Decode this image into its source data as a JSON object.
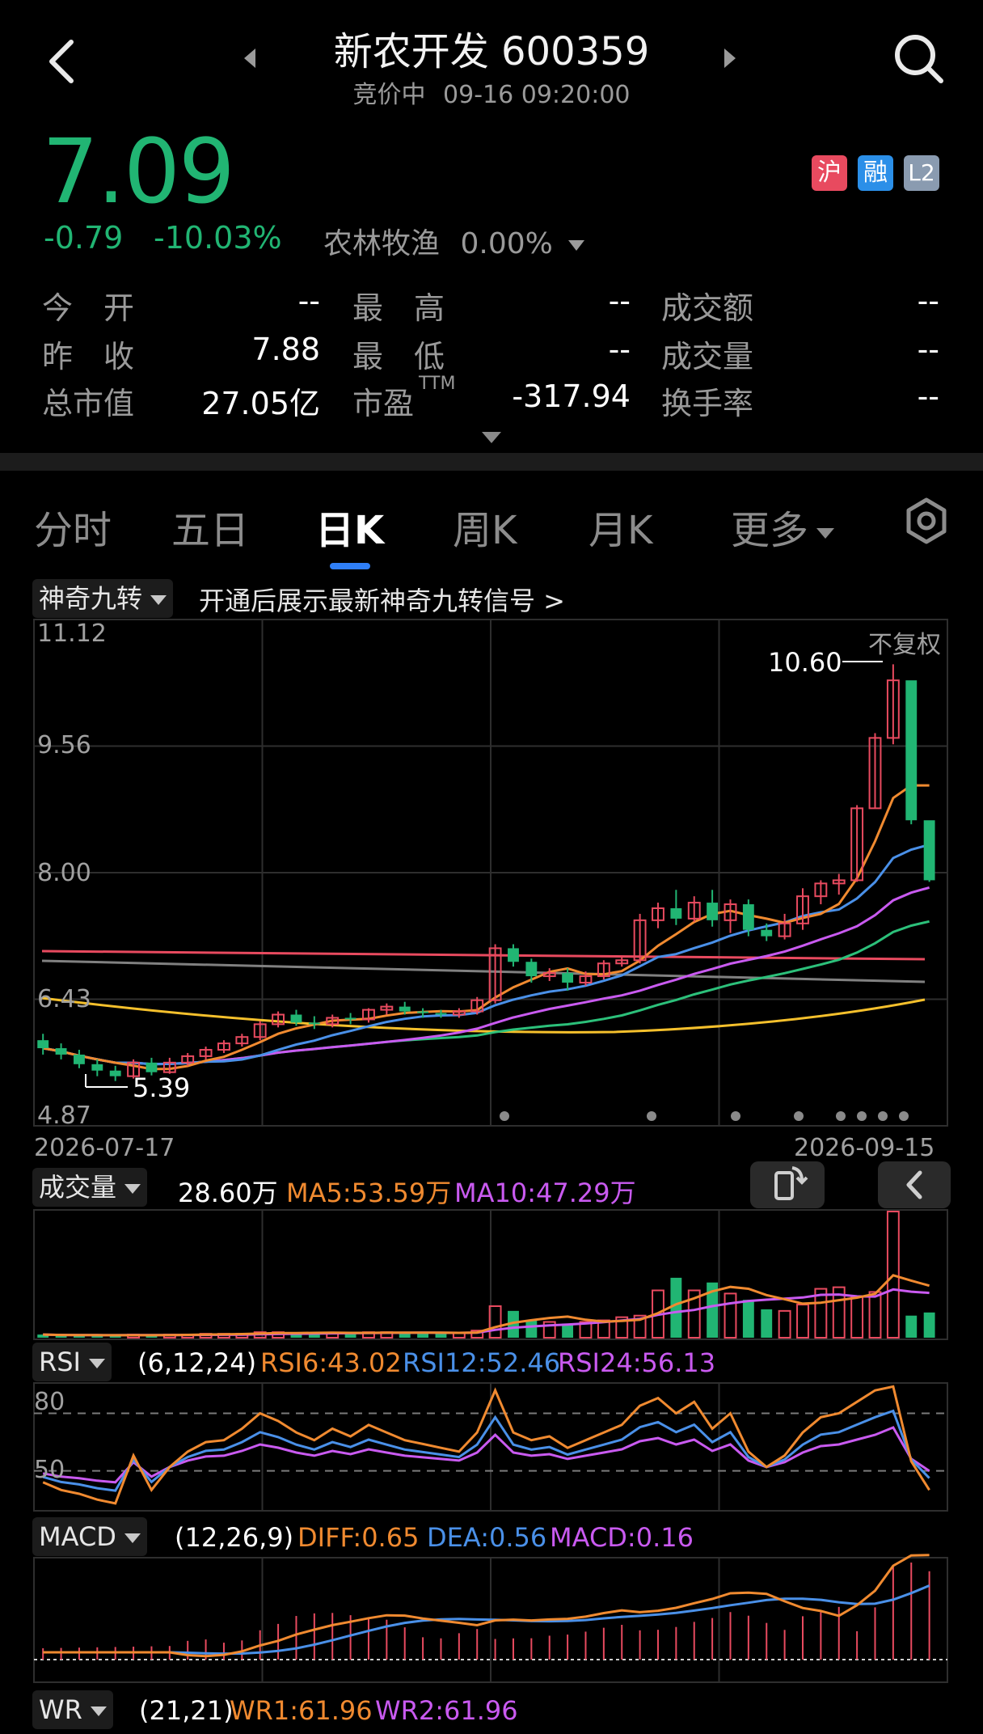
{
  "header": {
    "title": "新农开发 600359",
    "status": "竞价中",
    "datetime": "09-16 09:20:00"
  },
  "quote": {
    "price": "7.09",
    "change": "-0.79",
    "change_pct": "-10.03%",
    "sector_name": "农林牧渔",
    "sector_pct": "0.00%",
    "badges": [
      {
        "text": "沪",
        "color": "#e84a5f"
      },
      {
        "text": "融",
        "color": "#2b8fe8"
      },
      {
        "text": "L2",
        "color": "#8a9bb0"
      }
    ],
    "rows": [
      [
        {
          "label": "今　开",
          "value": "--"
        },
        {
          "label": "最　高",
          "value": "--"
        },
        {
          "label": "成交额",
          "value": "--"
        }
      ],
      [
        {
          "label": "昨　收",
          "value": "7.88"
        },
        {
          "label": "最　低",
          "value": "--"
        },
        {
          "label": "成交量",
          "value": "--"
        }
      ],
      [
        {
          "label": "总市值",
          "value": "27.05亿"
        },
        {
          "label": "市盈",
          "value": "-317.94"
        },
        {
          "label": "换手率",
          "value": "--"
        }
      ]
    ],
    "pe_sup": "TTM"
  },
  "tabs": [
    "分时",
    "五日",
    "日K",
    "周K",
    "月K",
    "更多"
  ],
  "active_tab": "日K",
  "kline": {
    "indicator_select": "神奇九转",
    "promo_text": "开通后展示最新神奇九转信号 >",
    "adjust_label": "不复权",
    "y_ticks": [
      "11.12",
      "9.56",
      "8.00",
      "6.43",
      "4.87"
    ],
    "date_start": "2026-07-17",
    "date_end": "2026-09-15",
    "max_label": "10.60",
    "min_label": "5.39"
  },
  "volume": {
    "select": "成交量",
    "current": "28.60万",
    "ma5": "MA5:53.59万",
    "ma10": "MA10:47.29万"
  },
  "rsi": {
    "select": "RSI",
    "params": "(6,12,24)",
    "rsi6": "RSI6:43.02",
    "rsi12": "RSI12:52.46",
    "rsi24": "RSI24:56.13",
    "levels": [
      "80",
      "50"
    ]
  },
  "macd": {
    "select": "MACD",
    "params": "(12,26,9)",
    "diff": "DIFF:0.65",
    "dea": "DEA:0.56",
    "macd": "MACD:0.16"
  },
  "wr": {
    "select": "WR",
    "params": "(21,21)",
    "wr1": "WR1:61.96",
    "wr2": "WR2:61.96"
  },
  "colors": {
    "up": "#e84a5f",
    "down": "#21b573",
    "ma5": "#f08a30",
    "ma10": "#4a90e8",
    "ma20": "#c95af0",
    "ma30": "#2cc07a",
    "ma60": "#808080",
    "ma120": "#f5c02c",
    "ma250": "#e84a5f"
  },
  "chart_data": {
    "type": "candlestick",
    "x_range": [
      "2026-07-17",
      "2026-09-15"
    ],
    "ylim": [
      4.87,
      11.12
    ],
    "candles": [
      [
        5.9,
        5.8,
        5.98,
        5.72
      ],
      [
        5.8,
        5.72,
        5.86,
        5.66
      ],
      [
        5.72,
        5.6,
        5.78,
        5.55
      ],
      [
        5.6,
        5.52,
        5.66,
        5.45
      ],
      [
        5.52,
        5.45,
        5.58,
        5.39
      ],
      [
        5.45,
        5.62,
        5.66,
        5.42
      ],
      [
        5.62,
        5.5,
        5.68,
        5.46
      ],
      [
        5.5,
        5.62,
        5.68,
        5.48
      ],
      [
        5.62,
        5.7,
        5.74,
        5.58
      ],
      [
        5.7,
        5.78,
        5.82,
        5.66
      ],
      [
        5.78,
        5.86,
        5.9,
        5.74
      ],
      [
        5.86,
        5.94,
        5.98,
        5.82
      ],
      [
        5.94,
        6.1,
        6.14,
        5.9
      ],
      [
        6.1,
        6.22,
        6.26,
        6.06
      ],
      [
        6.22,
        6.12,
        6.28,
        6.08
      ],
      [
        6.12,
        6.1,
        6.2,
        6.04
      ],
      [
        6.1,
        6.18,
        6.22,
        6.06
      ],
      [
        6.18,
        6.16,
        6.24,
        6.1
      ],
      [
        6.16,
        6.28,
        6.3,
        6.12
      ],
      [
        6.28,
        6.32,
        6.36,
        6.22
      ],
      [
        6.32,
        6.26,
        6.38,
        6.22
      ],
      [
        6.26,
        6.24,
        6.3,
        6.18
      ],
      [
        6.24,
        6.22,
        6.28,
        6.18
      ],
      [
        6.22,
        6.26,
        6.3,
        6.18
      ],
      [
        6.26,
        6.4,
        6.44,
        6.22
      ],
      [
        6.4,
        7.05,
        7.1,
        6.36
      ],
      [
        7.05,
        6.88,
        7.1,
        6.82
      ],
      [
        6.88,
        6.7,
        6.92,
        6.62
      ],
      [
        6.7,
        6.74,
        6.8,
        6.64
      ],
      [
        6.74,
        6.62,
        6.8,
        6.52
      ],
      [
        6.62,
        6.7,
        6.76,
        6.58
      ],
      [
        6.7,
        6.86,
        6.9,
        6.66
      ],
      [
        6.86,
        6.9,
        6.96,
        6.82
      ],
      [
        6.9,
        7.4,
        7.48,
        6.86
      ],
      [
        7.4,
        7.55,
        7.62,
        7.3
      ],
      [
        7.55,
        7.42,
        7.78,
        7.34
      ],
      [
        7.42,
        7.62,
        7.7,
        7.38
      ],
      [
        7.62,
        7.4,
        7.78,
        7.32
      ],
      [
        7.4,
        7.6,
        7.66,
        7.24
      ],
      [
        7.6,
        7.28,
        7.66,
        7.2
      ],
      [
        7.28,
        7.2,
        7.36,
        7.14
      ],
      [
        7.2,
        7.36,
        7.48,
        7.16
      ],
      [
        7.36,
        7.7,
        7.8,
        7.28
      ],
      [
        7.7,
        7.86,
        7.9,
        7.6
      ],
      [
        7.86,
        7.9,
        7.98,
        7.72
      ],
      [
        7.9,
        8.8,
        8.84,
        7.88
      ],
      [
        8.8,
        9.68,
        9.74,
        8.8
      ],
      [
        9.68,
        10.4,
        10.6,
        9.6
      ],
      [
        10.4,
        8.65,
        8.7,
        8.6
      ],
      [
        8.65,
        7.9,
        8.0,
        7.88
      ]
    ]
  }
}
